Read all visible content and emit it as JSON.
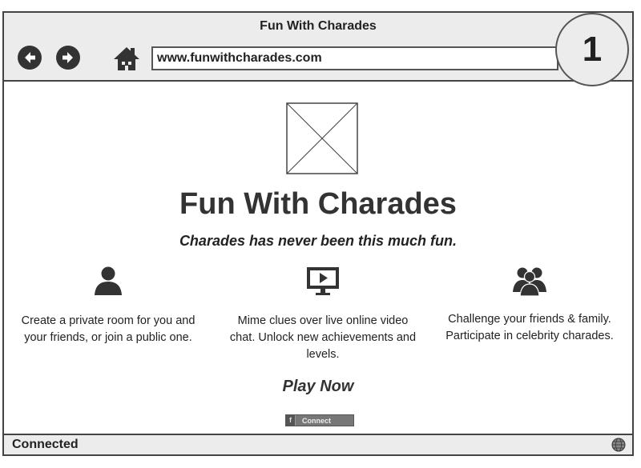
{
  "window": {
    "title": "Fun With Charades",
    "url": "www.funwithcharades.com",
    "page_number": "1"
  },
  "nav": {
    "back_icon": "arrow-left-icon",
    "forward_icon": "arrow-right-icon",
    "home_icon": "home-icon"
  },
  "hero": {
    "image_icon": "image-placeholder",
    "title": "Fun With Charades",
    "subtitle": "Charades has never been this much fun."
  },
  "features": [
    {
      "icon": "user-icon",
      "text": "Create a private room for you and your friends, or join a public one."
    },
    {
      "icon": "monitor-play-icon",
      "text": "Mime clues over live online video chat. Unlock new achievements and levels."
    },
    {
      "icon": "group-icon",
      "text": "Challenge your friends & family. Participate in celebrity charades."
    }
  ],
  "cta": {
    "play_now": "Play Now",
    "connect_label": "Connect",
    "connect_icon": "facebook-icon"
  },
  "status": {
    "text": "Connected",
    "icon": "globe-icon"
  }
}
